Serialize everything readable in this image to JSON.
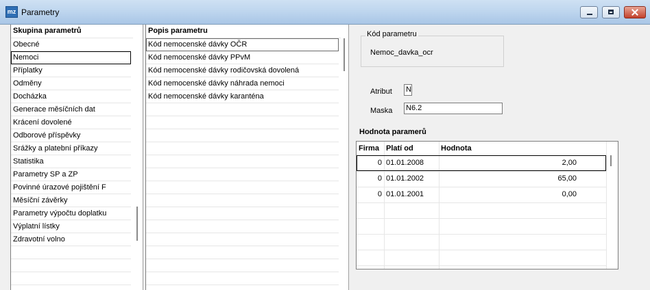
{
  "window": {
    "title": "Parametry",
    "icon_label": "mz",
    "controls": [
      "minimize",
      "maximize",
      "close"
    ]
  },
  "groups_panel": {
    "header": "Skupina parametrů",
    "items": [
      {
        "label": "Obecné"
      },
      {
        "label": "Nemoci",
        "selected": true
      },
      {
        "label": "Příplatky"
      },
      {
        "label": "Odměny"
      },
      {
        "label": "Docházka"
      },
      {
        "label": "Generace měsíčních dat"
      },
      {
        "label": "Krácení dovolené"
      },
      {
        "label": "Odborové příspěvky"
      },
      {
        "label": "Srážky a platební příkazy"
      },
      {
        "label": "Statistika"
      },
      {
        "label": "Parametry SP a ZP"
      },
      {
        "label": "Povinné úrazové pojištění F"
      },
      {
        "label": "Měsíční závěrky"
      },
      {
        "label": "Parametry výpočtu doplatku"
      },
      {
        "label": "Výplatní lístky"
      },
      {
        "label": "Zdravotní volno"
      }
    ]
  },
  "params_panel": {
    "header": "Popis parametru",
    "items": [
      {
        "label": "Kód nemocenské dávky OČR",
        "selected": true
      },
      {
        "label": "Kód nemocenské dávky PPvM"
      },
      {
        "label": "Kód nemocenské dávky rodičovská dovolená"
      },
      {
        "label": "Kód nemocenské dávky náhrada nemoci"
      },
      {
        "label": "Kód nemocenské dávky karanténa"
      }
    ]
  },
  "detail": {
    "code_group_title": "Kód parametru",
    "code_value": "Nemoc_davka_ocr",
    "attribute_label": "Atribut",
    "attribute_value": "N",
    "mask_label": "Maska",
    "mask_value": "N6.2",
    "values_title": "Hodnota paramerů",
    "values_table": {
      "columns": [
        "Firma",
        "Platí od",
        "Hodnota"
      ],
      "rows": [
        {
          "firma": "0",
          "plati_od": "01.01.2008",
          "hodnota": "2,00"
        },
        {
          "firma": "0",
          "plati_od": "01.01.2002",
          "hodnota": "65,00"
        },
        {
          "firma": "0",
          "plati_od": "01.01.2001",
          "hodnota": "0,00"
        }
      ]
    }
  }
}
